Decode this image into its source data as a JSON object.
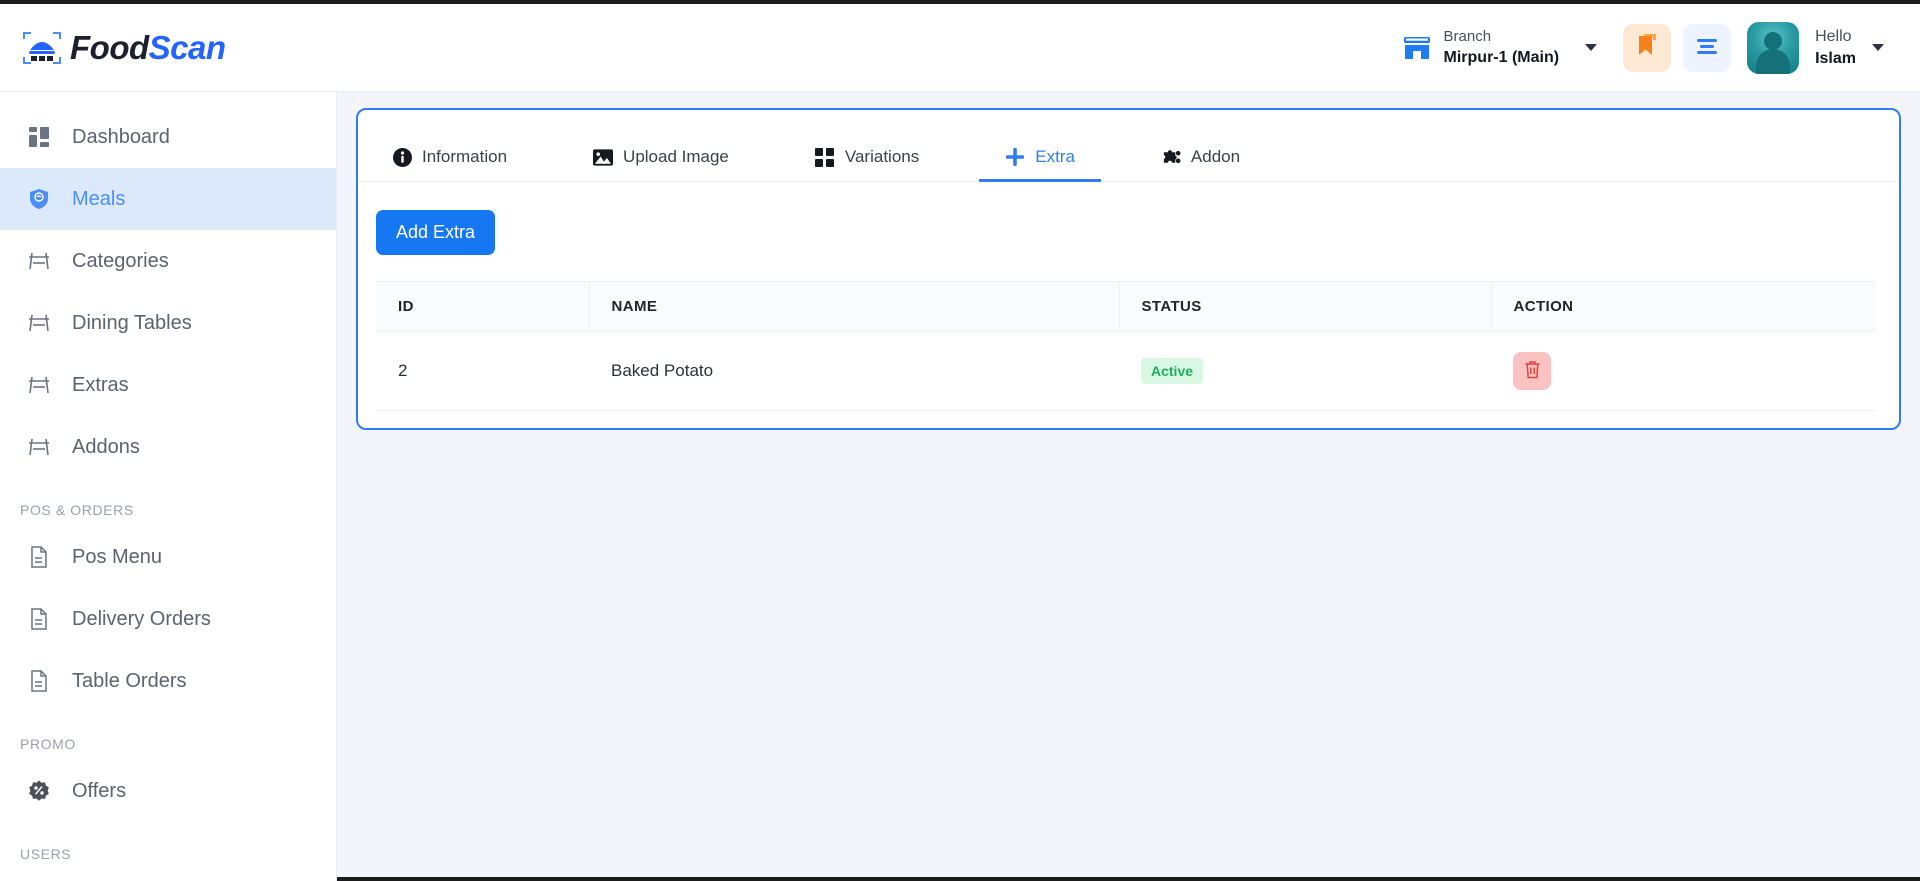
{
  "brand": {
    "food": "Food",
    "scan": "Scan",
    "logo_icon": "food-dome-qr-icon"
  },
  "header": {
    "branch_label": "Branch",
    "branch_value": "Mirpur-1 (Main)",
    "branch_icon": "store-icon",
    "branch_caret_icon": "chevron-down-icon",
    "bookmark_icon": "bookmark-icon",
    "menu_icon": "hamburger-menu-icon",
    "avatar_icon": "user-avatar",
    "hello_label": "Hello",
    "user_name": "Islam",
    "user_caret_icon": "chevron-down-icon"
  },
  "sidebar": {
    "items": [
      {
        "label": "Dashboard",
        "icon": "dashboard-grid-icon",
        "active": false
      },
      {
        "label": "Meals",
        "icon": "shield-meal-icon",
        "active": true
      },
      {
        "label": "Categories",
        "icon": "picnic-table-icon",
        "active": false
      },
      {
        "label": "Dining Tables",
        "icon": "picnic-table-icon",
        "active": false
      },
      {
        "label": "Extras",
        "icon": "picnic-table-icon",
        "active": false
      },
      {
        "label": "Addons",
        "icon": "picnic-table-icon",
        "active": false
      }
    ],
    "group_pos": "POS & ORDERS",
    "pos_items": [
      {
        "label": "Pos Menu",
        "icon": "document-list-icon"
      },
      {
        "label": "Delivery Orders",
        "icon": "document-list-icon"
      },
      {
        "label": "Table Orders",
        "icon": "document-list-icon"
      }
    ],
    "group_promo": "PROMO",
    "promo_items": [
      {
        "label": "Offers",
        "icon": "discount-badge-icon"
      }
    ],
    "group_users": "USERS"
  },
  "main": {
    "tabs": [
      {
        "label": "Information",
        "icon": "info-circle-icon",
        "active": false
      },
      {
        "label": "Upload Image",
        "icon": "image-icon",
        "active": false
      },
      {
        "label": "Variations",
        "icon": "grid-squares-icon",
        "active": false
      },
      {
        "label": "Extra",
        "icon": "plus-icon",
        "active": true
      },
      {
        "label": "Addon",
        "icon": "puzzle-piece-icon",
        "active": false
      }
    ],
    "add_button": "Add Extra",
    "table": {
      "columns": [
        "ID",
        "NAME",
        "STATUS",
        "ACTION"
      ],
      "rows": [
        {
          "id": "2",
          "name": "Baked Potato",
          "status": "Active",
          "action_icon": "trash-delete-icon"
        }
      ]
    }
  },
  "colors": {
    "accent_blue": "#2f7cf6",
    "brand_blue": "#2563ff",
    "active_nav_bg": "#dbe9fb",
    "status_green_text": "#1fae5f",
    "status_green_bg": "#d8f8e3",
    "delete_bg": "#fbc2c2",
    "bookmark_bg": "#fde8d3"
  }
}
